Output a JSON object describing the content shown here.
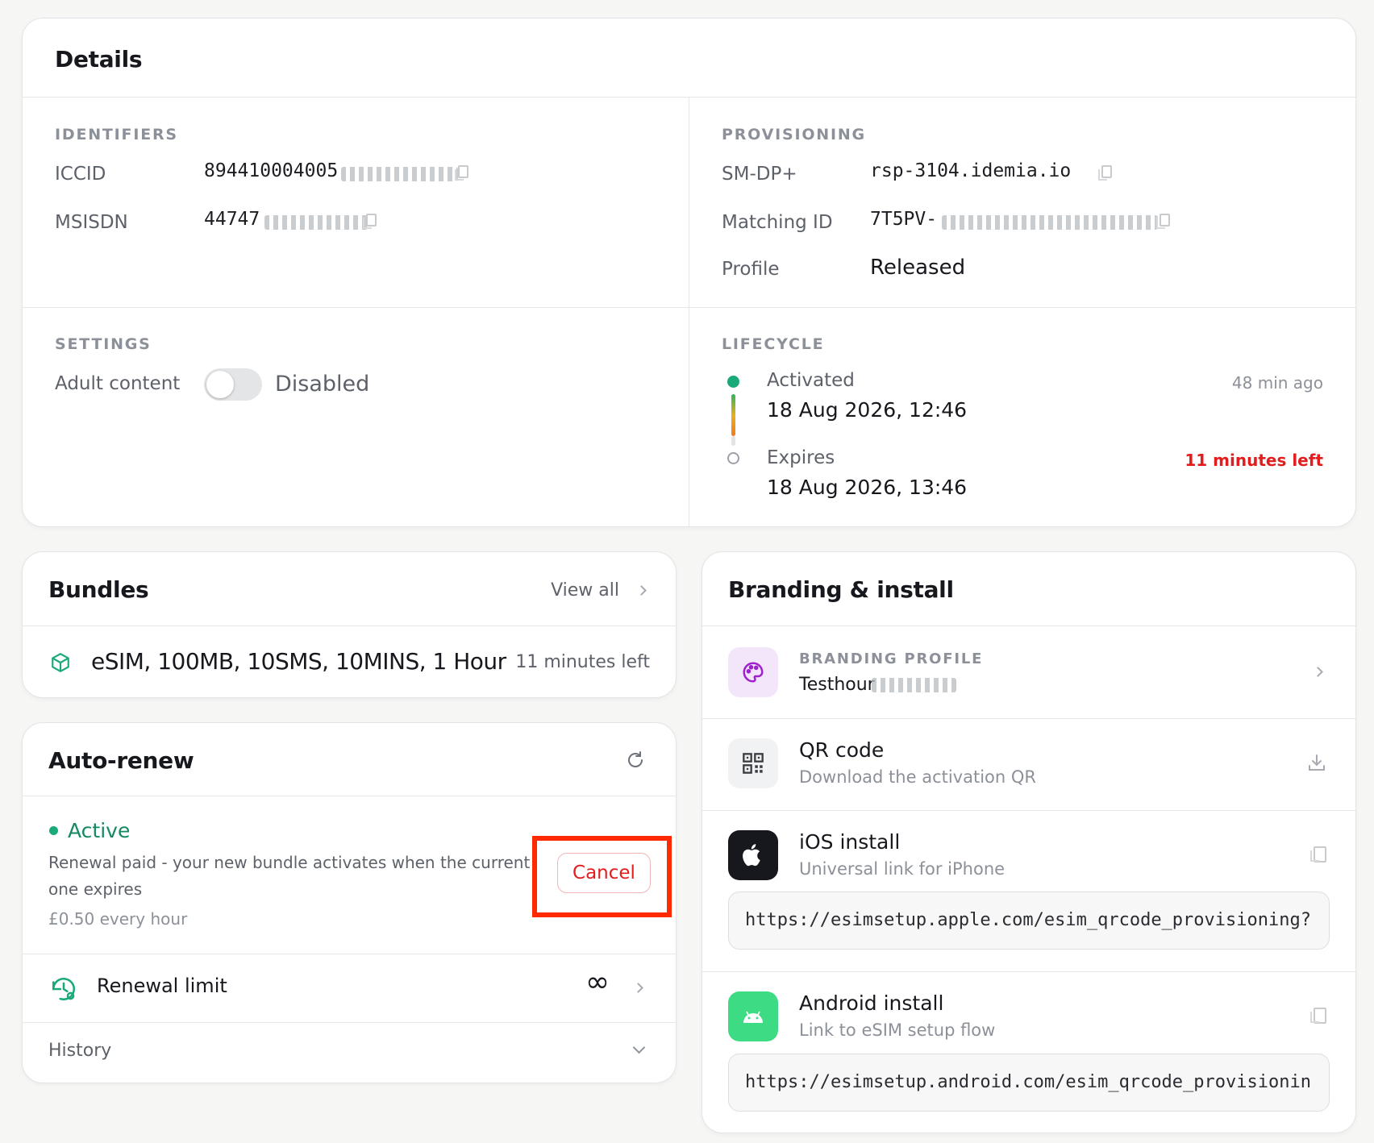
{
  "details": {
    "title": "Details",
    "identifiers": {
      "section": "IDENTIFIERS",
      "iccid_label": "ICCID",
      "iccid_value": "894410004005",
      "msisdn_label": "MSISDN",
      "msisdn_value": "44747"
    },
    "provisioning": {
      "section": "PROVISIONING",
      "smdp_label": "SM-DP+",
      "smdp_value": "rsp-3104.idemia.io",
      "matching_label": "Matching ID",
      "matching_value": "7T5PV-",
      "profile_label": "Profile",
      "profile_value": "Released"
    },
    "settings": {
      "section": "SETTINGS",
      "adult_label": "Adult content",
      "adult_state": "Disabled"
    },
    "lifecycle": {
      "section": "LIFECYCLE",
      "activated_label": "Activated",
      "activated_date": "18 Aug 2026, 12:46",
      "activated_ago": "48 min ago",
      "expires_label": "Expires",
      "expires_date": "18 Aug 2026, 13:46",
      "expires_left": "11 minutes left"
    }
  },
  "bundles": {
    "title": "Bundles",
    "view_all": "View all",
    "item_name": "eSIM, 100MB, 10SMS, 10MINS, 1 Hour",
    "item_remaining": "11 minutes left"
  },
  "autorenew": {
    "title": "Auto-renew",
    "status": "Active",
    "description_line1": "Renewal paid - your new bundle activates when the current",
    "description_line2": "one expires",
    "price": "£0.50 every hour",
    "cancel_label": "Cancel",
    "limit_label": "Renewal limit",
    "limit_value": "∞",
    "history_label": "History"
  },
  "branding": {
    "title": "Branding & install",
    "profile_section": "BRANDING PROFILE",
    "profile_value": "Testhour",
    "qr_title": "QR code",
    "qr_subtitle": "Download the activation QR",
    "ios_title": "iOS install",
    "ios_subtitle": "Universal link for iPhone",
    "ios_url": "https://esimsetup.apple.com/esim_qrcode_provisioning?",
    "android_title": "Android install",
    "android_subtitle": "Link to eSIM setup flow",
    "android_url": "https://esimsetup.android.com/esim_qrcode_provisionin"
  },
  "colors": {
    "accent_green": "#1aaa78",
    "danger_red": "#e11d1d",
    "highlight_red": "#ff2a00",
    "android_green": "#3ddc84"
  }
}
